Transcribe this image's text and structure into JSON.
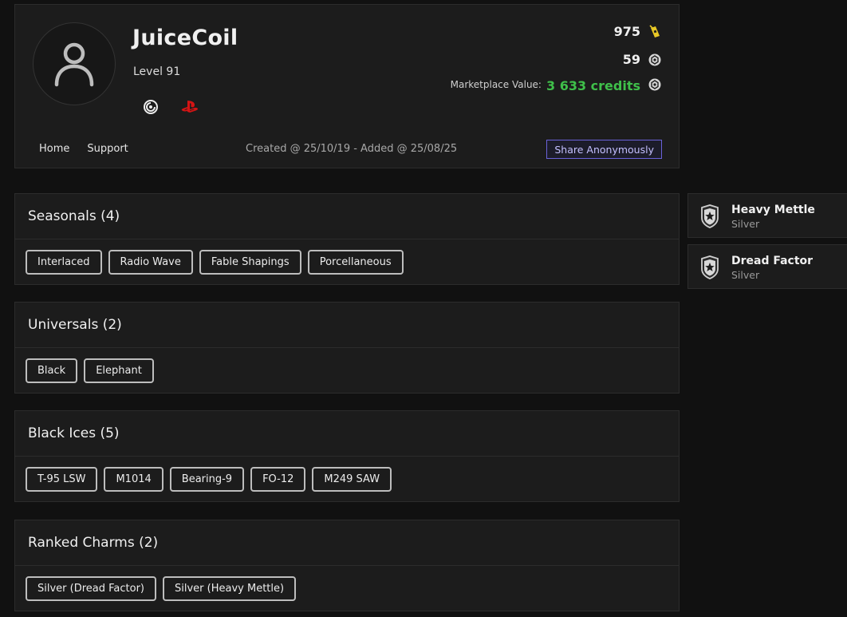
{
  "profile": {
    "username": "JuiceCoil",
    "level": "Level 91",
    "stats": {
      "renown": "975",
      "r6_credits": "59",
      "marketplace_label": "Marketplace Value:",
      "marketplace_value": "3 633 credits"
    },
    "nav": {
      "home": "Home",
      "support": "Support"
    },
    "dates": "Created @ 25/10/19 - Added @ 25/08/25",
    "share_label": "Share Anonymously",
    "platform_icons": [
      "ubisoft-icon",
      "playstation-icon"
    ]
  },
  "sections": [
    {
      "title": "Seasonals (4)",
      "items": [
        "Interlaced",
        "Radio Wave",
        "Fable Shapings",
        "Porcellaneous"
      ]
    },
    {
      "title": "Universals (2)",
      "items": [
        "Black",
        "Elephant"
      ]
    },
    {
      "title": "Black Ices (5)",
      "items": [
        "T-95 LSW",
        "M1014",
        "Bearing-9",
        "FO-12",
        "M249 SAW"
      ]
    },
    {
      "title": "Ranked Charms (2)",
      "items": [
        "Silver (Dread Factor)",
        "Silver (Heavy Mettle)"
      ]
    }
  ],
  "charms": [
    {
      "name": "Heavy Mettle",
      "rank": "Silver"
    },
    {
      "name": "Dread Factor",
      "rank": "Silver"
    }
  ],
  "colors": {
    "background": "#111111",
    "panel": "#1c1c1c",
    "credits_green": "#3fbf4a",
    "renown_yellow": "#e8c826",
    "playstation_red": "#d41414",
    "share_accent": "#6a62d8"
  }
}
